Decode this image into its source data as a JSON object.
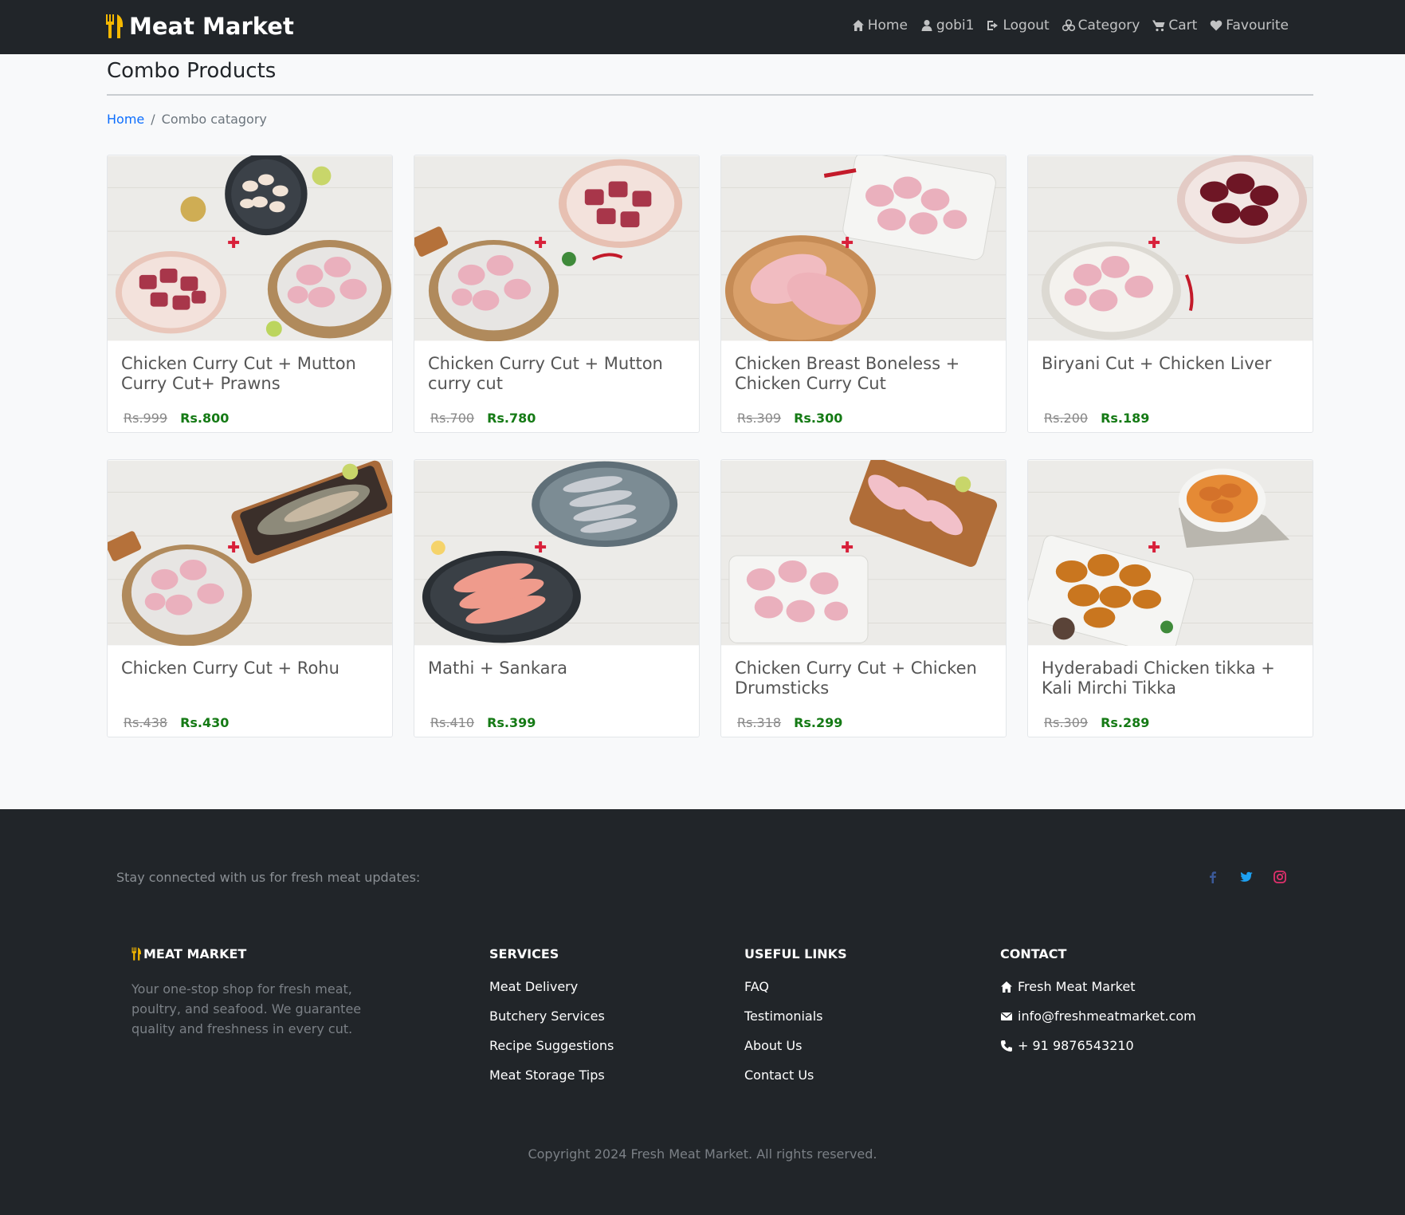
{
  "navbar": {
    "brand": "Meat Market",
    "links": [
      {
        "label": "Home",
        "icon": "home-icon"
      },
      {
        "label": "gobi1",
        "icon": "user-icon"
      },
      {
        "label": "Logout",
        "icon": "logout-icon"
      },
      {
        "label": "Category",
        "icon": "category-icon"
      },
      {
        "label": "Cart",
        "icon": "cart-icon"
      },
      {
        "label": "Favourite",
        "icon": "heart-icon"
      }
    ]
  },
  "page": {
    "title": "Combo Products",
    "breadcrumb": {
      "home": "Home",
      "separator": "/",
      "current": "Combo catagory"
    }
  },
  "products": [
    {
      "title": "Chicken Curry Cut + Mutton Curry Cut+ Prawns",
      "old_price": "Rs.999",
      "price": "Rs.800"
    },
    {
      "title": "Chicken Curry Cut + Mutton curry cut",
      "old_price": "Rs.700",
      "price": "Rs.780"
    },
    {
      "title": "Chicken Breast Boneless + Chicken Curry Cut",
      "old_price": "Rs.309",
      "price": "Rs.300"
    },
    {
      "title": "Biryani Cut + Chicken Liver",
      "old_price": "Rs.200",
      "price": "Rs.189"
    },
    {
      "title": "Chicken Curry Cut + Rohu",
      "old_price": "Rs.438",
      "price": "Rs.430"
    },
    {
      "title": "Mathi + Sankara",
      "old_price": "Rs.410",
      "price": "Rs.399"
    },
    {
      "title": "Chicken Curry Cut + Chicken Drumsticks",
      "old_price": "Rs.318",
      "price": "Rs.299"
    },
    {
      "title": "Hyderabadi Chicken tikka + Kali Mirchi Tikka",
      "old_price": "Rs.309",
      "price": "Rs.289"
    }
  ],
  "footer": {
    "stay_connected": "Stay connected with us for fresh meat updates:",
    "social": [
      {
        "icon": "facebook-icon",
        "color": "#3b5998"
      },
      {
        "icon": "twitter-icon",
        "color": "#1da1f2"
      },
      {
        "icon": "instagram-icon",
        "color": "#e1306c"
      }
    ],
    "brand_heading": "MEAT MARKET",
    "about": "Your one-stop shop for fresh meat, poultry, and seafood. We guarantee quality and freshness in every cut.",
    "services_heading": "SERVICES",
    "services": [
      "Meat Delivery",
      "Butchery Services",
      "Recipe Suggestions",
      "Meat Storage Tips"
    ],
    "useful_heading": "USEFUL LINKS",
    "useful": [
      "FAQ",
      "Testimonials",
      "About Us",
      "Contact Us"
    ],
    "contact_heading": "CONTACT",
    "contact": {
      "name": "Fresh Meat Market",
      "email": "info@freshmeatmarket.com",
      "phone": "+ 91 9876543210"
    },
    "copyright": "Copyright 2024 Fresh Meat Market. All rights reserved."
  },
  "colors": {
    "nav_bg": "#212529",
    "accent": "#0d6efd",
    "price": "#157a15",
    "brand_icon": "#f5b800"
  }
}
